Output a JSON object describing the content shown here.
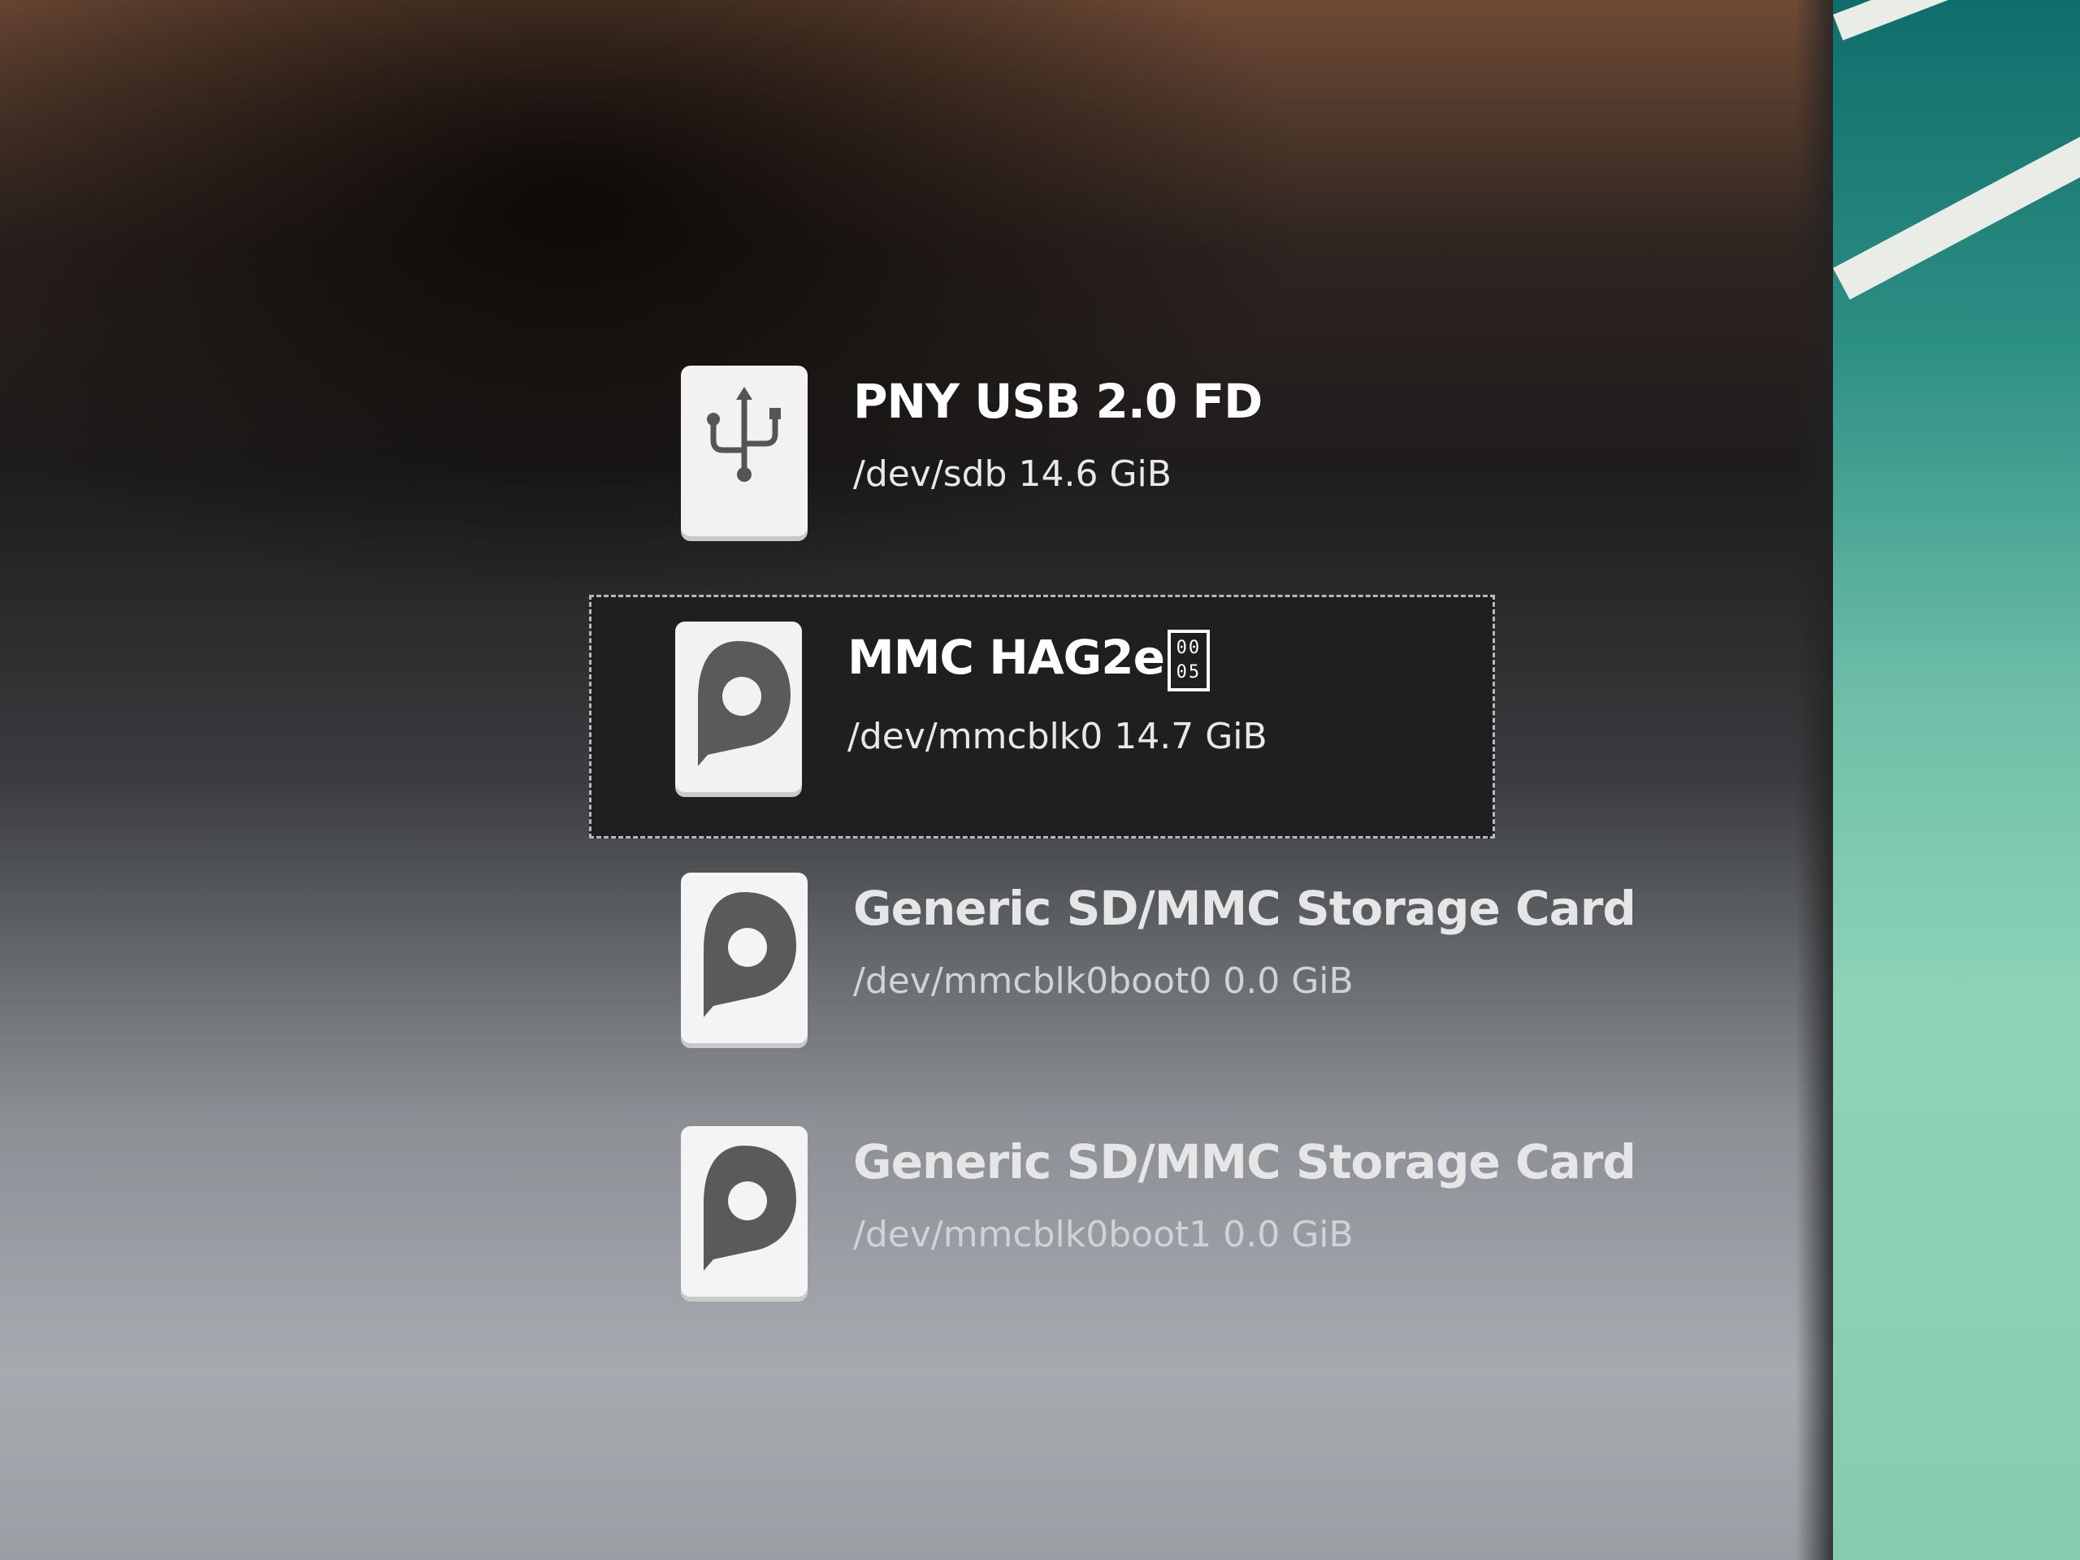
{
  "devices": [
    {
      "name": "PNY USB 2.0 FD",
      "path": "/dev/sdb",
      "size": "14.6 GiB",
      "icon": "usb-drive-icon",
      "selected": false
    },
    {
      "name": "MMC HAG2e",
      "name_glyph": [
        "00",
        "05"
      ],
      "path": "/dev/mmcblk0",
      "size": "14.7 GiB",
      "icon": "storage-card-icon",
      "selected": true
    },
    {
      "name": "Generic SD/MMC Storage Card",
      "path": "/dev/mmcblk0boot0",
      "size": "0.0 GiB",
      "icon": "storage-card-icon",
      "selected": false
    },
    {
      "name": "Generic SD/MMC Storage Card",
      "path": "/dev/mmcblk0boot1",
      "size": "0.0 GiB",
      "icon": "storage-card-icon",
      "selected": false
    }
  ],
  "colors": {
    "selected_background": "#1e1f21",
    "icon_background": "#f2f2f2",
    "icon_glyph": "#5a5a5a"
  }
}
